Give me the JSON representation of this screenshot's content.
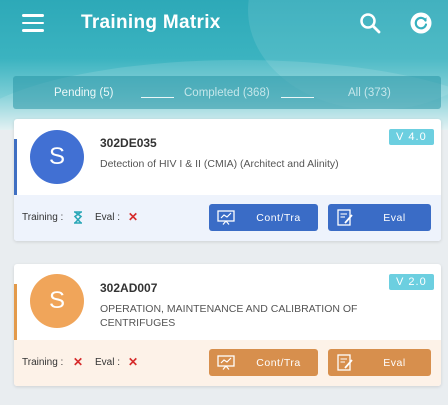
{
  "app": {
    "title": "Training Matrix"
  },
  "header": {
    "menu_icon": "hamburger-icon",
    "search_icon": "search-icon",
    "refresh_icon": "refresh-icon"
  },
  "tabs": [
    {
      "label": "Pending",
      "count": "(5)"
    },
    {
      "label": "Completed",
      "count": "(368)"
    },
    {
      "label": "All",
      "count": "(373)"
    }
  ],
  "cards": [
    {
      "initial": "S",
      "code": "302DE035",
      "description": "Detection of HIV I & II (CMIA) (Architect and Alinity)",
      "version": "V 4.0",
      "training_label": "Training :",
      "eval_label": "Eval :",
      "training_status": "hourglass-icon",
      "eval_status": "cross-icon",
      "btn_train": "Cont/Tra",
      "btn_eval": "Eval",
      "accent": "#3f6fc2",
      "avatar_color": "#4170d3",
      "footer_bg": "#eef3fc"
    },
    {
      "initial": "S",
      "code": "302AD007",
      "description_lines": [
        "OPERATION, MAINTENANCE AND CALIBRATION OF",
        "CENTRIFUGES"
      ],
      "version": "V 2.0",
      "training_label": "Training :",
      "eval_label": "Eval :",
      "training_status": "cross-icon",
      "eval_status": "cross-icon",
      "btn_train": "Cont/Tra",
      "btn_eval": "Eval",
      "accent": "#e39a4a",
      "avatar_color": "#f0a55a",
      "footer_bg": "#fdf2e8"
    }
  ],
  "colors": {
    "cross": "#d62b2b",
    "hourglass": "#2aa7b7",
    "version_bg": "#6ccfe0"
  }
}
